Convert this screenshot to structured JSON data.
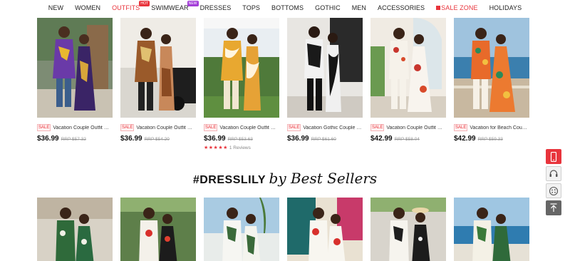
{
  "nav": {
    "items": [
      {
        "label": "NEW"
      },
      {
        "label": "WOMEN"
      },
      {
        "label": "OUTFITS",
        "badge": "HOT"
      },
      {
        "label": "SWIMWEAR",
        "badge": "NEW"
      },
      {
        "label": "DRESSES"
      },
      {
        "label": "TOPS"
      },
      {
        "label": "BOTTOMS"
      },
      {
        "label": "GOTHIC"
      },
      {
        "label": "MEN"
      },
      {
        "label": "ACCESSORIES"
      },
      {
        "label": "SALE ZONE"
      },
      {
        "label": "HOLIDAYS"
      }
    ]
  },
  "products": [
    {
      "sale": "SALE",
      "title": "Vacation Couple Outfit Matching Set",
      "price": "$36.99",
      "rrp": "RRP $57.32"
    },
    {
      "sale": "SALE",
      "title": "Vacation Couple Outfit Matching Set",
      "price": "$36.99",
      "rrp": "RRP $54.20"
    },
    {
      "sale": "SALE",
      "title": "Vacation Couple Outfit Matching Set",
      "price": "$36.99",
      "rrp": "RRP $53.63",
      "stars": "★★★★★",
      "reviews": "1 Reviews"
    },
    {
      "sale": "SALE",
      "title": "Vacation Gothic Couple Matching Set",
      "price": "$36.99",
      "rrp": "RRP $61.60"
    },
    {
      "sale": "SALE",
      "title": "Vacation Couple Outfit Matching Set",
      "price": "$42.99",
      "rrp": "RRP $58.04"
    },
    {
      "sale": "SALE",
      "title": "Vacation for Beach Couple Matching Set",
      "price": "$42.99",
      "rrp": "RRP $59.33"
    }
  ],
  "bestsellers": {
    "brand": "#DRESSLILY",
    "tagline": "by Best Sellers"
  },
  "colors": {
    "accent": "#e8343c",
    "hot_badge": "#e8343c",
    "new_badge": "#a43fd8"
  },
  "icons": [
    "phone-icon",
    "headset-icon",
    "chat-icon",
    "back-to-top-icon"
  ]
}
